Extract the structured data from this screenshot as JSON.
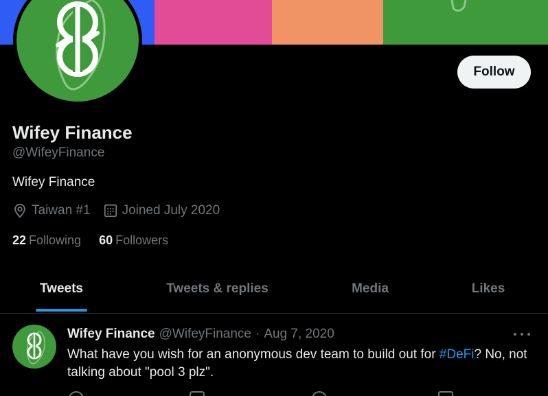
{
  "banner": {
    "colors": [
      "#2f5cf5",
      "#e24c96",
      "#f09466",
      "#3f9a3b"
    ]
  },
  "profile": {
    "avatar_icon": "wifey-finance-logo-icon",
    "follow_label": "Follow",
    "display_name": "Wifey Finance",
    "handle": "@WifeyFinance",
    "bio": "Wifey Finance",
    "location": "Taiwan #1",
    "joined": "Joined July 2020",
    "following_count": "22",
    "following_label": "Following",
    "followers_count": "60",
    "followers_label": "Followers"
  },
  "tabs": [
    {
      "label": "Tweets",
      "active": true
    },
    {
      "label": "Tweets & replies",
      "active": false
    },
    {
      "label": "Media",
      "active": false
    },
    {
      "label": "Likes",
      "active": false
    }
  ],
  "tweet": {
    "name": "Wifey Finance",
    "handle": "@WifeyFinance",
    "separator": "·",
    "date": "Aug 7, 2020",
    "text_before": "What have you wish for an anonymous dev team to build out for ",
    "hashtag": "#DeFi",
    "text_after": "? No, not talking about \"pool 3 plz\"."
  },
  "colors": {
    "accent": "#1d9bf0",
    "muted": "#71767b",
    "text": "#e7e9ea",
    "avatar_green": "#3f9a3b"
  }
}
